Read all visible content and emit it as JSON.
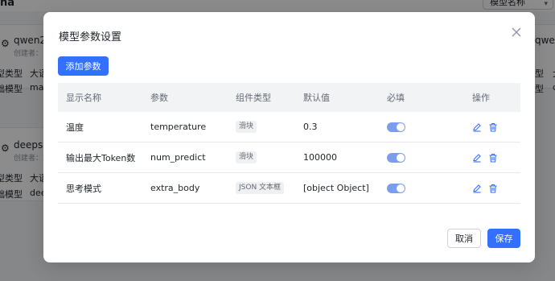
{
  "background": {
    "page_title_fragment": "na",
    "sort_select": "模型名称",
    "cards": [
      {
        "name": "qwen2.",
        "creator": "创建者：刻",
        "field1_label": "型类型",
        "field1_value": "大语",
        "field2_label": "础模型",
        "field2_value": "maa"
      },
      {
        "name": "deepse",
        "creator": "创建者：刻",
        "field1_label": "型类型",
        "field1_value": "大语",
        "field2_label": "础模型",
        "field2_value": "dee"
      }
    ],
    "right_card": {
      "name": "qwe",
      "field1_label": "型",
      "field1_value": "大",
      "field2_label": "型",
      "field2_value": "d"
    }
  },
  "modal": {
    "title": "模型参数设置",
    "add_button": "添加参数",
    "columns": [
      "显示名称",
      "参数",
      "组件类型",
      "默认值",
      "必填",
      "操作"
    ],
    "rows": [
      {
        "display_name": "温度",
        "param": "temperature",
        "component": "滑块",
        "default": "0.3",
        "required": true
      },
      {
        "display_name": "输出最大Token数",
        "param": "num_predict",
        "component": "滑块",
        "default": "100000",
        "required": true
      },
      {
        "display_name": "思考模式",
        "param": "extra_body",
        "component": "JSON 文本框",
        "default": "[object Object]",
        "required": true
      }
    ],
    "cancel_button": "取消",
    "save_button": "保存"
  },
  "colors": {
    "primary": "#3370ff",
    "switch_on": "#7a9dee",
    "overlay": "rgba(0,0,0,0.45)"
  },
  "icons": {
    "close": "close-icon",
    "edit": "edit-icon",
    "delete": "delete-icon"
  }
}
